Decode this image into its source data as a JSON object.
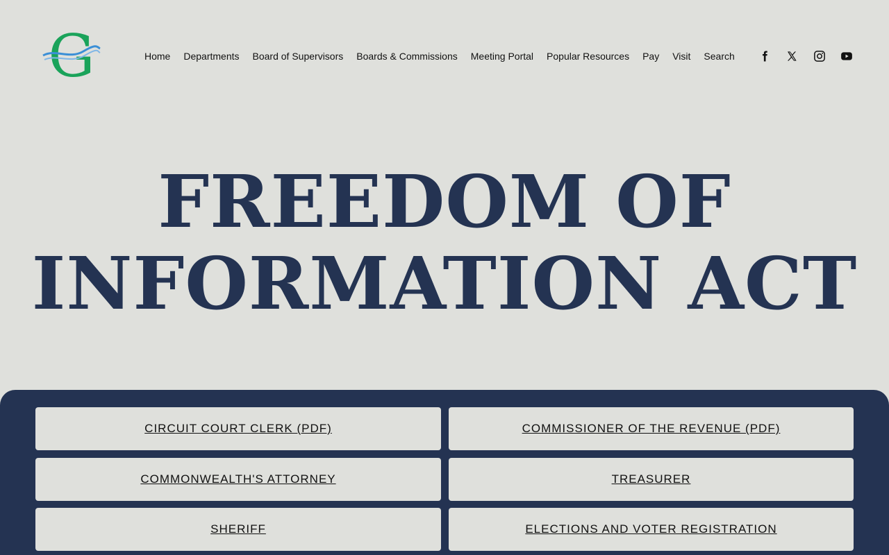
{
  "nav": {
    "items": [
      "Home",
      "Departments",
      "Board of Supervisors",
      "Boards & Commissions",
      "Meeting Portal",
      "Popular Resources",
      "Pay",
      "Visit",
      "Search"
    ]
  },
  "social": [
    "facebook-icon",
    "x-icon",
    "instagram-icon",
    "youtube-icon"
  ],
  "logo": {
    "icon": "county-g-logo",
    "letter": "G",
    "accent": "#1aa35a",
    "wave": "#3b8fd6"
  },
  "hero": {
    "line1": "FREEDOM OF",
    "line2": "INFORMATION ACT"
  },
  "colors": {
    "background": "#dfe0dc",
    "navy": "#243352",
    "button": "#dfe0dc"
  },
  "buttons": [
    "CIRCUIT COURT CLERK (PDF)",
    "COMMISSIONER OF THE REVENUE (PDF)",
    "COMMONWEALTH'S ATTORNEY",
    "TREASURER",
    "SHERIFF",
    "ELECTIONS AND VOTER REGISTRATION"
  ]
}
